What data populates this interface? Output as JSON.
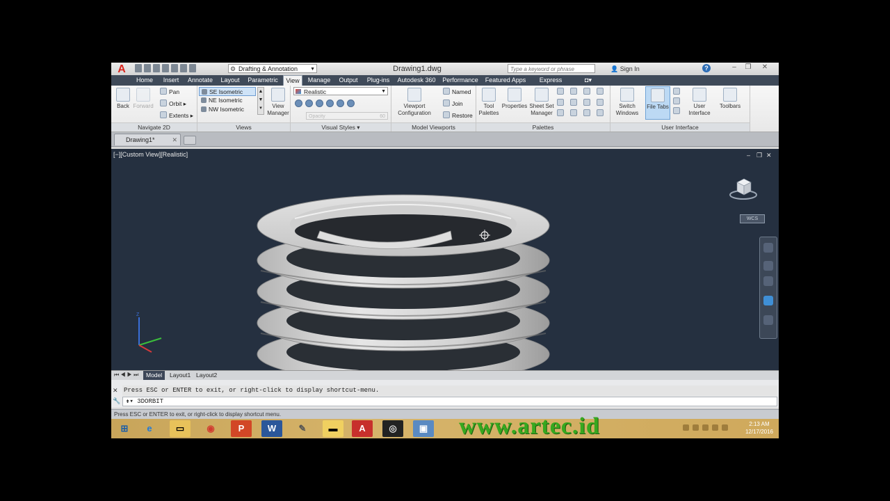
{
  "titlebar": {
    "app_logo": "A",
    "workspace": "Drafting & Annotation",
    "doc_title": "Drawing1.dwg",
    "search_placeholder": "Type a keyword or phrase",
    "signin": "Sign In",
    "help": "?"
  },
  "ribbon_tabs": [
    "Home",
    "Insert",
    "Annotate",
    "Layout",
    "Parametric",
    "View",
    "Manage",
    "Output",
    "Plug-ins",
    "Autodesk 360",
    "Performance",
    "Featured Apps",
    "Express Tools"
  ],
  "active_tab": "View",
  "panels": {
    "navigate2d": {
      "title": "Navigate 2D",
      "back": "Back",
      "forward": "Forward",
      "pan": "Pan",
      "orbit": "Orbit",
      "extents": "Extents"
    },
    "views": {
      "title": "Views",
      "items": [
        "SE Isometric",
        "NE Isometric",
        "NW Isometric"
      ],
      "view_manager_1": "View",
      "view_manager_2": "Manager"
    },
    "visual_styles": {
      "title": "Visual Styles",
      "current": "Realistic",
      "opacity_label": "Opacity",
      "opacity_value": "60"
    },
    "model_viewports": {
      "title": "Model Viewports",
      "config_1": "Viewport",
      "config_2": "Configuration",
      "named": "Named",
      "join": "Join",
      "restore": "Restore"
    },
    "palettes": {
      "title": "Palettes",
      "tool_1": "Tool",
      "tool_2": "Palettes",
      "properties": "Properties",
      "ssm_1": "Sheet Set",
      "ssm_2": "Manager"
    },
    "user_interface": {
      "title": "User Interface",
      "switch_1": "Switch",
      "switch_2": "Windows",
      "file_tabs": "File Tabs",
      "ui_1": "User",
      "ui_2": "Interface",
      "toolbars": "Toolbars"
    }
  },
  "file_tab": "Drawing1*",
  "viewport": {
    "label": "[−][Custom View][Realistic]",
    "wcs": "WCS"
  },
  "layout_tabs": [
    "Model",
    "Layout1",
    "Layout2"
  ],
  "command": {
    "history": "Press ESC or ENTER to exit, or right-click to display shortcut-menu.",
    "current": "3DORBIT"
  },
  "status_text": "Press ESC or ENTER to exit, or right-click to display shortcut menu.",
  "taskbar": {
    "watermark": "www.artec.id",
    "time": "2:13 AM",
    "date": "12/17/2016"
  }
}
